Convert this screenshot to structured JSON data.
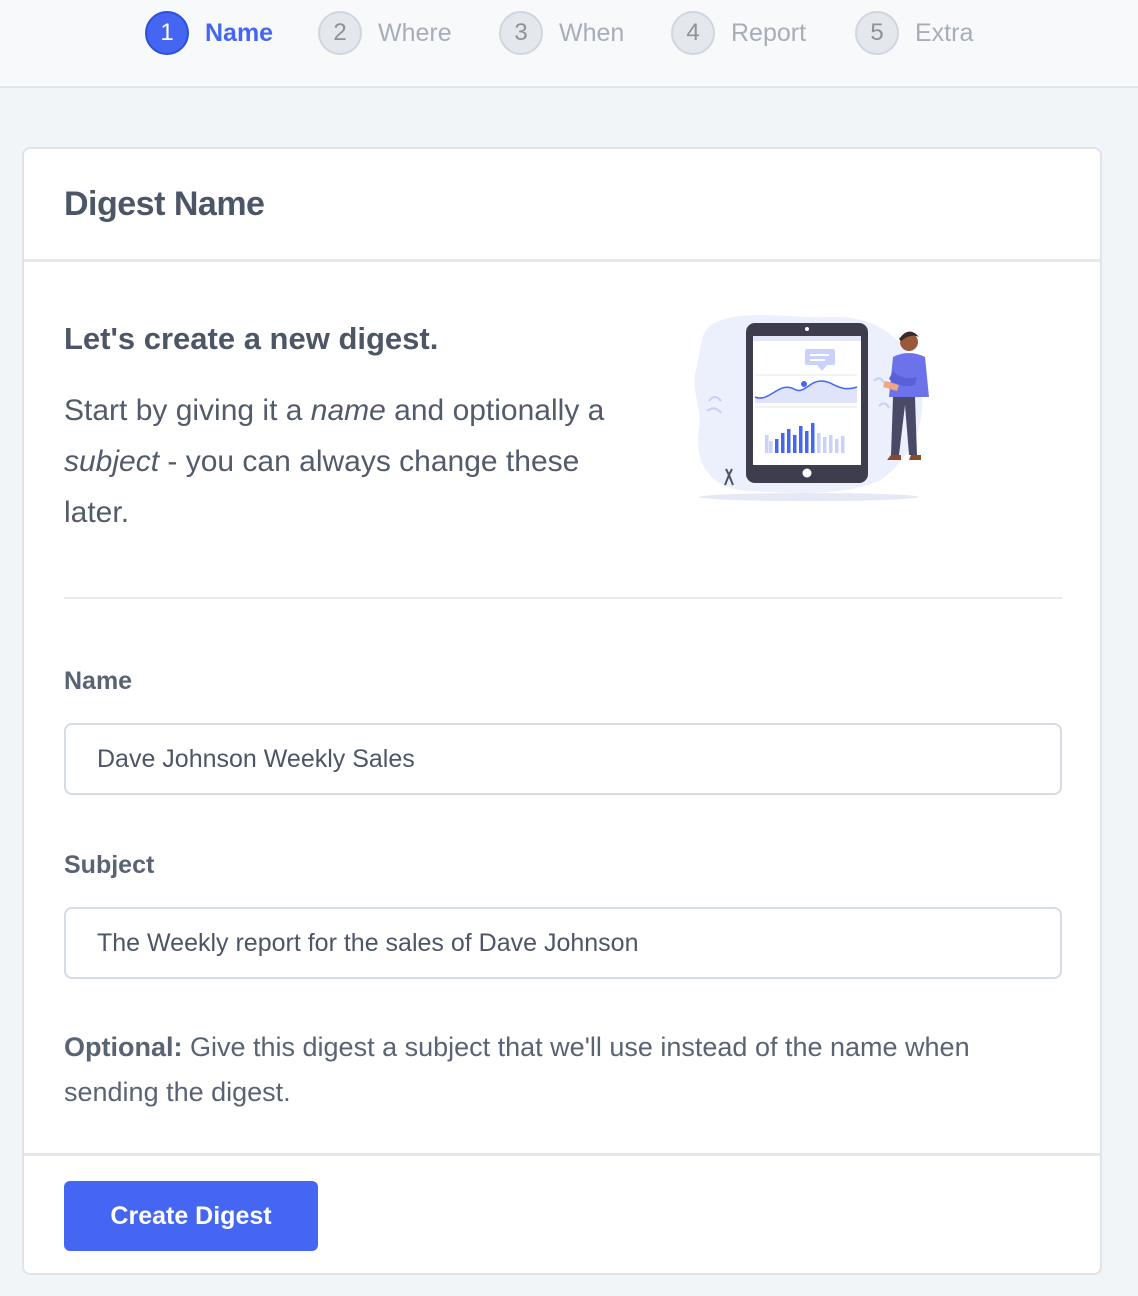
{
  "stepper": {
    "steps": [
      {
        "number": "1",
        "label": "Name",
        "state": "active"
      },
      {
        "number": "2",
        "label": "Where",
        "state": "inactive"
      },
      {
        "number": "3",
        "label": "When",
        "state": "inactive"
      },
      {
        "number": "4",
        "label": "Report",
        "state": "inactive"
      },
      {
        "number": "5",
        "label": "Extra",
        "state": "inactive"
      }
    ]
  },
  "card": {
    "title": "Digest Name",
    "intro_heading": "Let's create a new digest.",
    "intro_pre": "Start by giving it a ",
    "intro_em1": "name",
    "intro_mid": " and optionally a ",
    "intro_em2": "subject",
    "intro_post": " - you can always change these later.",
    "illustration": "person-with-tablet-chart-illustration"
  },
  "form": {
    "name_label": "Name",
    "name_value": "Dave Johnson Weekly Sales",
    "subject_label": "Subject",
    "subject_value": "The Weekly report for the sales of Dave Johnson",
    "hint_bold": "Optional:",
    "hint_text": " Give this digest a subject that we'll use instead of the name when sending the digest."
  },
  "footer": {
    "create_label": "Create Digest"
  },
  "colors": {
    "accent": "#4466f2",
    "background": "#f2f5f8",
    "text": "#525b6b"
  }
}
